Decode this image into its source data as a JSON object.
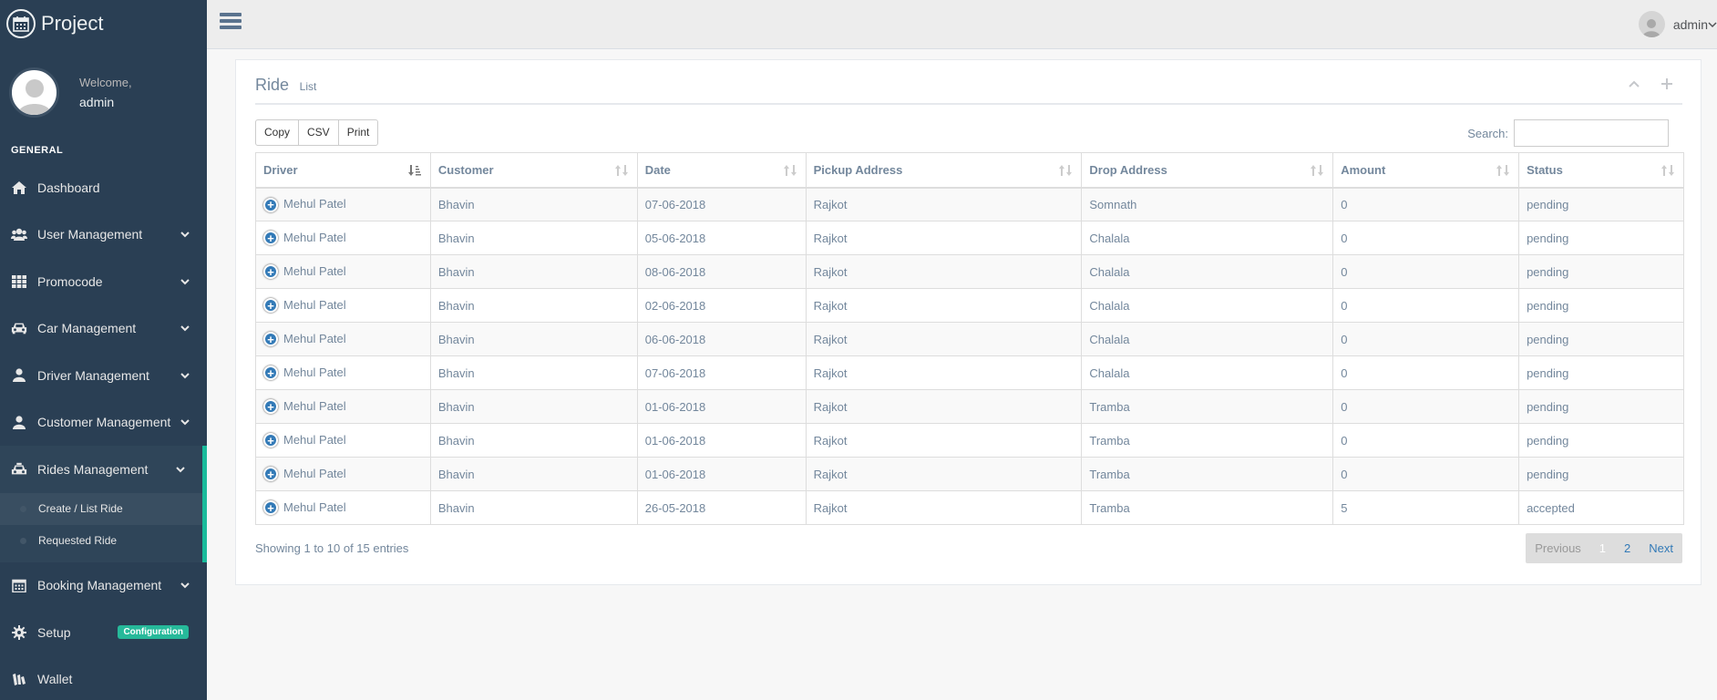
{
  "app": {
    "title": "Project"
  },
  "profile": {
    "welcome": "Welcome,",
    "name": "admin"
  },
  "sidebar": {
    "section": "GENERAL",
    "items": [
      {
        "label": "Dashboard",
        "icon": "home-icon"
      },
      {
        "label": "User Management",
        "icon": "users-icon"
      },
      {
        "label": "Promocode",
        "icon": "grid-icon"
      },
      {
        "label": "Car Management",
        "icon": "car-icon"
      },
      {
        "label": "Driver Management",
        "icon": "user-icon"
      },
      {
        "label": "Customer Management",
        "icon": "user-icon"
      },
      {
        "label": "Rides Management",
        "icon": "taxi-icon"
      },
      {
        "label": "Booking Management",
        "icon": "calendar-icon"
      },
      {
        "label": "Setup",
        "icon": "gear-icon",
        "badge": "Configuration"
      },
      {
        "label": "Wallet",
        "icon": "wallet-icon"
      }
    ],
    "sub_items": [
      {
        "label": "Create / List Ride"
      },
      {
        "label": "Requested Ride"
      }
    ]
  },
  "topbar": {
    "user": "admin"
  },
  "panel": {
    "title": "Ride",
    "subtitle": "List",
    "buttons": {
      "copy": "Copy",
      "csv": "CSV",
      "print": "Print"
    },
    "search_label": "Search:",
    "search_value": "",
    "columns": [
      "Driver",
      "Customer",
      "Date",
      "Pickup Address",
      "Drop Address",
      "Amount",
      "Status"
    ],
    "rows": [
      [
        "Mehul Patel",
        "Bhavin",
        "07-06-2018",
        "Rajkot",
        "Somnath",
        "0",
        "pending"
      ],
      [
        "Mehul Patel",
        "Bhavin",
        "05-06-2018",
        "Rajkot",
        "Chalala",
        "0",
        "pending"
      ],
      [
        "Mehul Patel",
        "Bhavin",
        "08-06-2018",
        "Rajkot",
        "Chalala",
        "0",
        "pending"
      ],
      [
        "Mehul Patel",
        "Bhavin",
        "02-06-2018",
        "Rajkot",
        "Chalala",
        "0",
        "pending"
      ],
      [
        "Mehul Patel",
        "Bhavin",
        "06-06-2018",
        "Rajkot",
        "Chalala",
        "0",
        "pending"
      ],
      [
        "Mehul Patel",
        "Bhavin",
        "07-06-2018",
        "Rajkot",
        "Chalala",
        "0",
        "pending"
      ],
      [
        "Mehul Patel",
        "Bhavin",
        "01-06-2018",
        "Rajkot",
        "Tramba",
        "0",
        "pending"
      ],
      [
        "Mehul Patel",
        "Bhavin",
        "01-06-2018",
        "Rajkot",
        "Tramba",
        "0",
        "pending"
      ],
      [
        "Mehul Patel",
        "Bhavin",
        "01-06-2018",
        "Rajkot",
        "Tramba",
        "0",
        "pending"
      ],
      [
        "Mehul Patel",
        "Bhavin",
        "26-05-2018",
        "Rajkot",
        "Tramba",
        "5",
        "accepted"
      ]
    ],
    "info": "Showing 1 to 10 of 15 entries",
    "pagination": {
      "previous": "Previous",
      "page1": "1",
      "page2": "2",
      "next": "Next"
    }
  },
  "colors": {
    "sidebar": "#2a3f54",
    "accent": "#1abb9c",
    "link": "#337ab7",
    "badge": "#26b99a"
  }
}
